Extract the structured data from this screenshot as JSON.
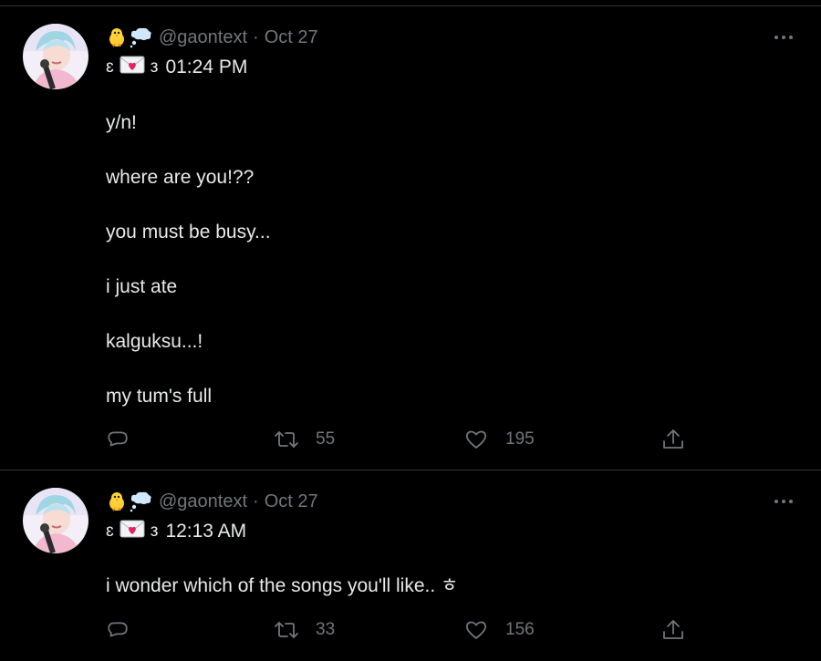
{
  "colors": {
    "background": "#000000",
    "text": "#e7e9ea",
    "secondary_text": "#71767b",
    "divider": "#2f3336",
    "heart_red": "#e0245e"
  },
  "tweets": [
    {
      "emoji_icons": [
        "baby-chick-icon",
        "thought-balloon-icon"
      ],
      "handle": "@gaontext",
      "separator": "·",
      "date": "Oct 27",
      "deco_left": "ɛ",
      "envelope_icon": "love-letter-icon",
      "deco_right": "з",
      "time": "01:24 PM",
      "paragraphs": [
        "y/n!",
        "where are you!??",
        "you must be busy...",
        "i just ate",
        "kalguksu...!",
        "my tum's full"
      ],
      "reply_count": "",
      "retweet_count": "55",
      "like_count": "195"
    },
    {
      "emoji_icons": [
        "baby-chick-icon",
        "thought-balloon-icon"
      ],
      "handle": "@gaontext",
      "separator": "·",
      "date": "Oct 27",
      "deco_left": "ɛ",
      "envelope_icon": "love-letter-icon",
      "deco_right": "з",
      "time": "12:13 AM",
      "paragraphs": [
        "i wonder which of the songs you'll like.. ㅎ"
      ],
      "reply_count": "",
      "retweet_count": "33",
      "like_count": "156"
    }
  ]
}
